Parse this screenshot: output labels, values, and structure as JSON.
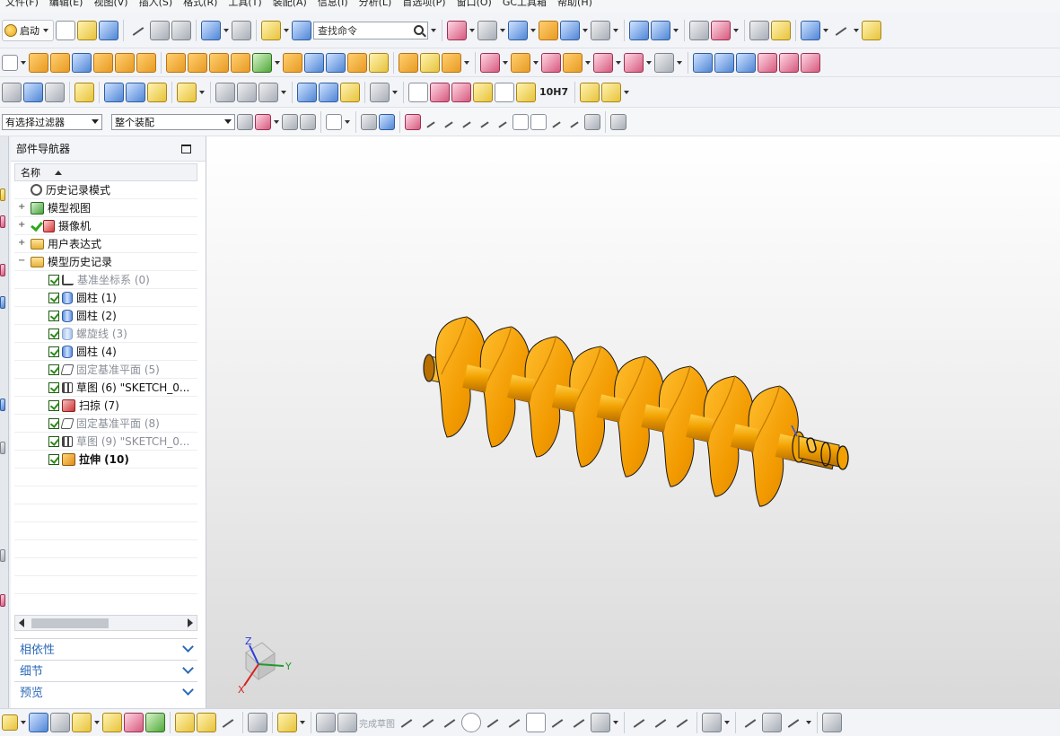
{
  "menu": [
    "文件(F)",
    "编辑(E)",
    "视图(V)",
    "插入(S)",
    "格式(R)",
    "工具(T)",
    "装配(A)",
    "信息(I)",
    "分析(L)",
    "首选项(P)",
    "窗口(O)",
    "GC工具箱",
    "帮助(H)"
  ],
  "toolbar": {
    "start_label": "启动",
    "find_placeholder": "查找命令",
    "fit_label": "10H7"
  },
  "selection": {
    "filter_value": "有选择过滤器",
    "scope_value": "整个装配"
  },
  "navigator": {
    "title": "部件导航器",
    "column_name": "名称",
    "rows": [
      {
        "label": "历史记录模式",
        "icon": "clock-icon"
      },
      {
        "label": "模型视图",
        "icon": "model-views-icon"
      },
      {
        "label": "摄像机",
        "icon": "camera-icon"
      },
      {
        "label": "用户表达式",
        "icon": "folder-icon"
      },
      {
        "label": "模型历史记录",
        "icon": "folder-open-icon"
      },
      {
        "label": "基准坐标系 (0)",
        "icon": "datum-csys-icon"
      },
      {
        "label": "圆柱 (1)",
        "icon": "cylinder-icon"
      },
      {
        "label": "圆柱 (2)",
        "icon": "cylinder-icon"
      },
      {
        "label": "螺旋线 (3)",
        "icon": "helix-icon"
      },
      {
        "label": "圆柱 (4)",
        "icon": "cylinder-icon"
      },
      {
        "label": "固定基准平面 (5)",
        "icon": "datum-plane-icon"
      },
      {
        "label": "草图 (6) \"SKETCH_0...",
        "icon": "sketch-icon"
      },
      {
        "label": "扫掠 (7)",
        "icon": "sweep-icon"
      },
      {
        "label": "固定基准平面 (8)",
        "icon": "datum-plane-icon"
      },
      {
        "label": "草图 (9) \"SKETCH_0...",
        "icon": "sketch-icon"
      },
      {
        "label": "拉伸 (10)",
        "icon": "extrude-icon"
      }
    ],
    "panels": [
      "相依性",
      "细节",
      "预览"
    ]
  },
  "triad": {
    "z": "Z",
    "y": "Y",
    "x": "X"
  },
  "sketch_bar": {
    "finish_label": "完成草图"
  },
  "colors": {
    "screw": "#f2a100",
    "screw_dark": "#b86f00",
    "accent_blue": "#2b6ab8"
  }
}
